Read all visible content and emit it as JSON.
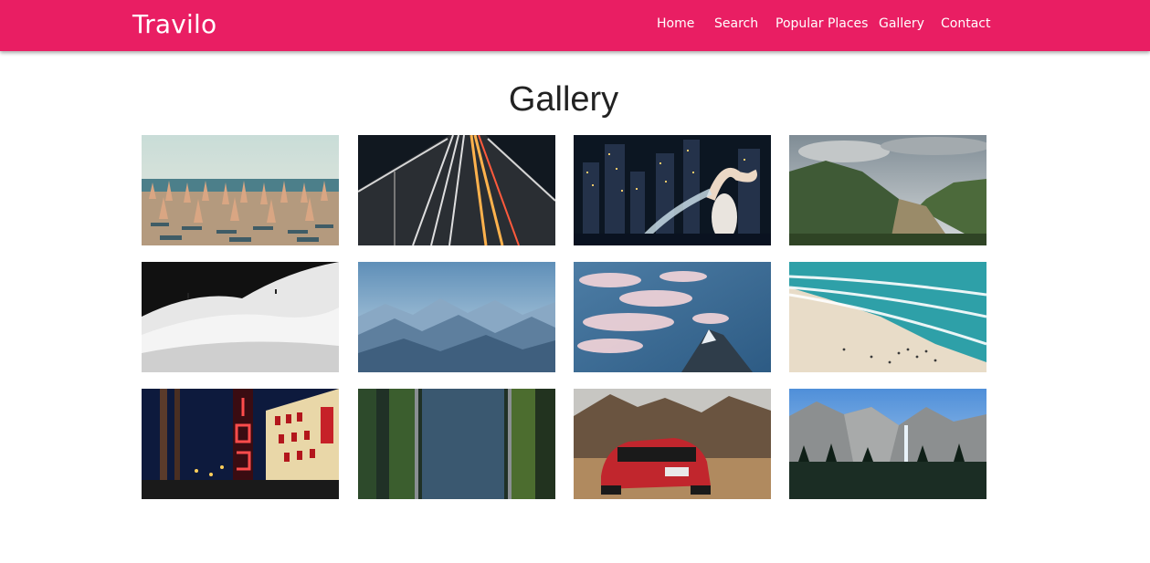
{
  "brand": "Travilo",
  "nav": {
    "home": "Home",
    "search": "Search",
    "popular": "Popular Places",
    "gallery": "Gallery",
    "contact": "Contact"
  },
  "colors": {
    "navbar": "#e91e63",
    "text": "#222222",
    "background": "#ffffff"
  },
  "page_title": "Gallery",
  "gallery": [
    {
      "subject": "beach-umbrellas-photo"
    },
    {
      "subject": "highway-light-trails-photo"
    },
    {
      "subject": "merlion-night-city-photo"
    },
    {
      "subject": "river-gorge-photo"
    },
    {
      "subject": "snow-dunes-bw-photo"
    },
    {
      "subject": "mountain-range-aerial-photo"
    },
    {
      "subject": "pink-clouds-peak-photo"
    },
    {
      "subject": "beach-aerial-photo"
    },
    {
      "subject": "neon-theater-signs-photo"
    },
    {
      "subject": "canal-aerial-photo"
    },
    {
      "subject": "red-mustang-photo"
    },
    {
      "subject": "valley-waterfall-photo"
    }
  ]
}
